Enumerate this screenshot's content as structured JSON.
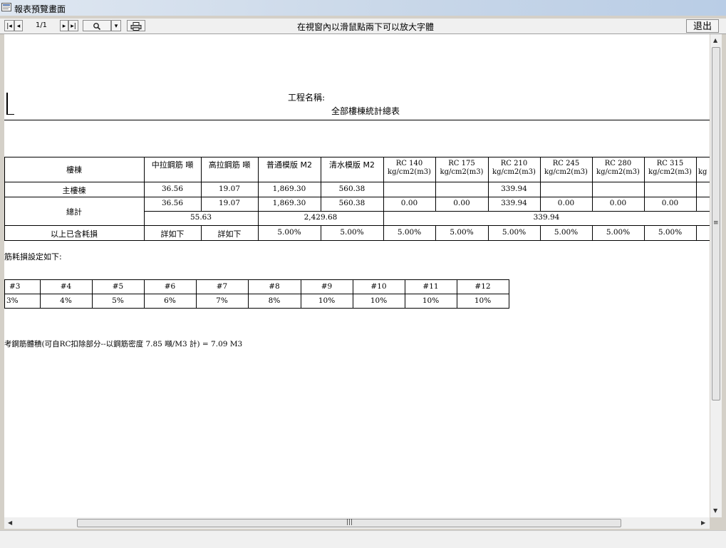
{
  "window": {
    "title": "報表預覽畫面"
  },
  "toolbar": {
    "page_indicator": "1/1",
    "hint": "在視窗內以滑鼠點兩下可以放大字體",
    "exit_label": "退出"
  },
  "report": {
    "project_label": "工程名稱:",
    "subtitle": "全部樓棟統計總表",
    "table1": {
      "headers": [
        "樓棟",
        "中拉鋼筋 噸",
        "高拉鋼筋 噸",
        "普通模版 M2",
        "清水模版 M2",
        "RC 140\nkg/cm2(m3)",
        "RC 175\nkg/cm2(m3)",
        "RC 210\nkg/cm2(m3)",
        "RC 245\nkg/cm2(m3)",
        "RC 280\nkg/cm2(m3)",
        "RC 315\nkg/cm2(m3)",
        "kg"
      ],
      "row_main": {
        "label": "主樓棟",
        "values": [
          "36.56",
          "19.07",
          "1,869.30",
          "560.38",
          "",
          "",
          "339.94",
          "",
          "",
          ""
        ]
      },
      "row_total": {
        "label": "總計",
        "values": [
          "36.56",
          "19.07",
          "1,869.30",
          "560.38",
          "0.00",
          "0.00",
          "339.94",
          "0.00",
          "0.00",
          "0.00"
        ],
        "sums": [
          "55.63",
          "2,429.68",
          "339.94"
        ]
      },
      "row_loss": {
        "label": "以上已含耗損",
        "values": [
          "詳如下",
          "詳如下",
          "5.00%",
          "5.00%",
          "5.00%",
          "5.00%",
          "5.00%",
          "5.00%",
          "5.00%",
          "5.00%"
        ]
      }
    },
    "loss_note": "筋耗損設定如下:",
    "table2": {
      "headers": [
        "#3",
        "#4",
        "#5",
        "#6",
        "#7",
        "#8",
        "#9",
        "#10",
        "#11",
        "#12"
      ],
      "values": [
        "3%",
        "4%",
        "5%",
        "6%",
        "7%",
        "8%",
        "10%",
        "10%",
        "10%",
        "10%"
      ]
    },
    "footer_note": "考鋼筋體積(可自RC扣除部分--以鋼筋密度 7.85 噸/M3 計) = 7.09 M3"
  }
}
